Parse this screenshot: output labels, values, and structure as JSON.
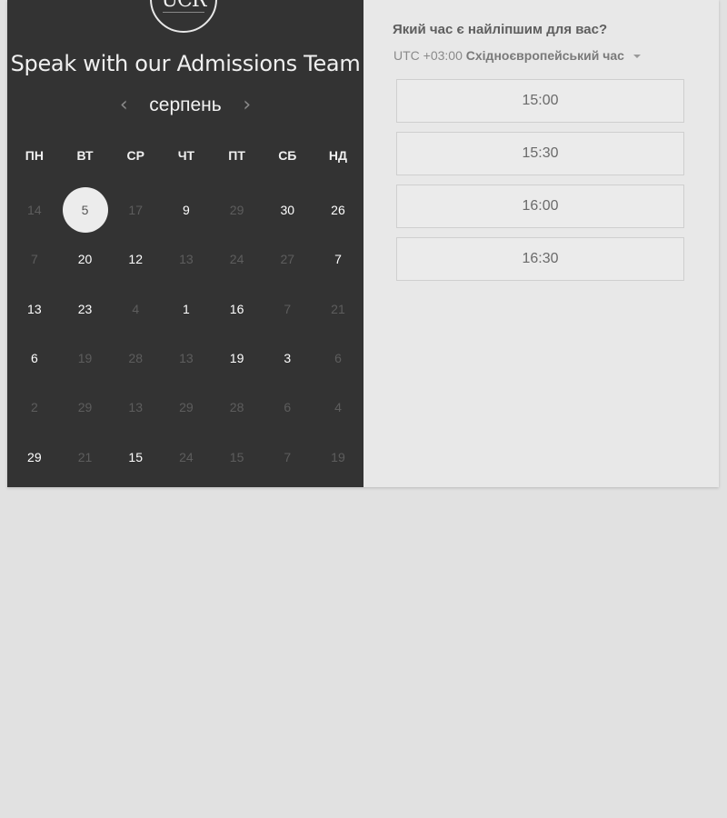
{
  "logo": {
    "text": "UCR"
  },
  "title": "Speak with our Admissions Team",
  "calendar": {
    "month": "серпень",
    "weekdays": [
      "ПН",
      "ВТ",
      "СР",
      "ЧТ",
      "ПТ",
      "СБ",
      "НД"
    ],
    "days": [
      {
        "label": "14",
        "state": "unavailable"
      },
      {
        "label": "5",
        "state": "selected"
      },
      {
        "label": "17",
        "state": "unavailable"
      },
      {
        "label": "9",
        "state": "available"
      },
      {
        "label": "29",
        "state": "unavailable"
      },
      {
        "label": "30",
        "state": "available"
      },
      {
        "label": "26",
        "state": "available"
      },
      {
        "label": "7",
        "state": "unavailable"
      },
      {
        "label": "20",
        "state": "available"
      },
      {
        "label": "12",
        "state": "available"
      },
      {
        "label": "13",
        "state": "unavailable"
      },
      {
        "label": "24",
        "state": "unavailable"
      },
      {
        "label": "27",
        "state": "unavailable"
      },
      {
        "label": "7",
        "state": "available"
      },
      {
        "label": "13",
        "state": "available"
      },
      {
        "label": "23",
        "state": "available"
      },
      {
        "label": "4",
        "state": "unavailable"
      },
      {
        "label": "1",
        "state": "available"
      },
      {
        "label": "16",
        "state": "available"
      },
      {
        "label": "7",
        "state": "unavailable"
      },
      {
        "label": "21",
        "state": "unavailable"
      },
      {
        "label": "6",
        "state": "available"
      },
      {
        "label": "19",
        "state": "unavailable"
      },
      {
        "label": "28",
        "state": "unavailable"
      },
      {
        "label": "13",
        "state": "unavailable"
      },
      {
        "label": "19",
        "state": "available"
      },
      {
        "label": "3",
        "state": "available"
      },
      {
        "label": "6",
        "state": "unavailable"
      },
      {
        "label": "2",
        "state": "unavailable"
      },
      {
        "label": "29",
        "state": "unavailable"
      },
      {
        "label": "13",
        "state": "unavailable"
      },
      {
        "label": "29",
        "state": "unavailable"
      },
      {
        "label": "28",
        "state": "unavailable"
      },
      {
        "label": "6",
        "state": "unavailable"
      },
      {
        "label": "4",
        "state": "unavailable"
      },
      {
        "label": "29",
        "state": "available"
      },
      {
        "label": "21",
        "state": "unavailable"
      },
      {
        "label": "15",
        "state": "available"
      },
      {
        "label": "24",
        "state": "unavailable"
      },
      {
        "label": "15",
        "state": "unavailable"
      },
      {
        "label": "7",
        "state": "unavailable"
      },
      {
        "label": "19",
        "state": "unavailable"
      }
    ]
  },
  "scheduler": {
    "question": "Який час є найліпшим для вас?",
    "timezone_offset": "UTC +03:00",
    "timezone_name": "Східноєвропейський час",
    "slots": [
      "15:00",
      "15:30",
      "16:00",
      "16:30"
    ]
  }
}
